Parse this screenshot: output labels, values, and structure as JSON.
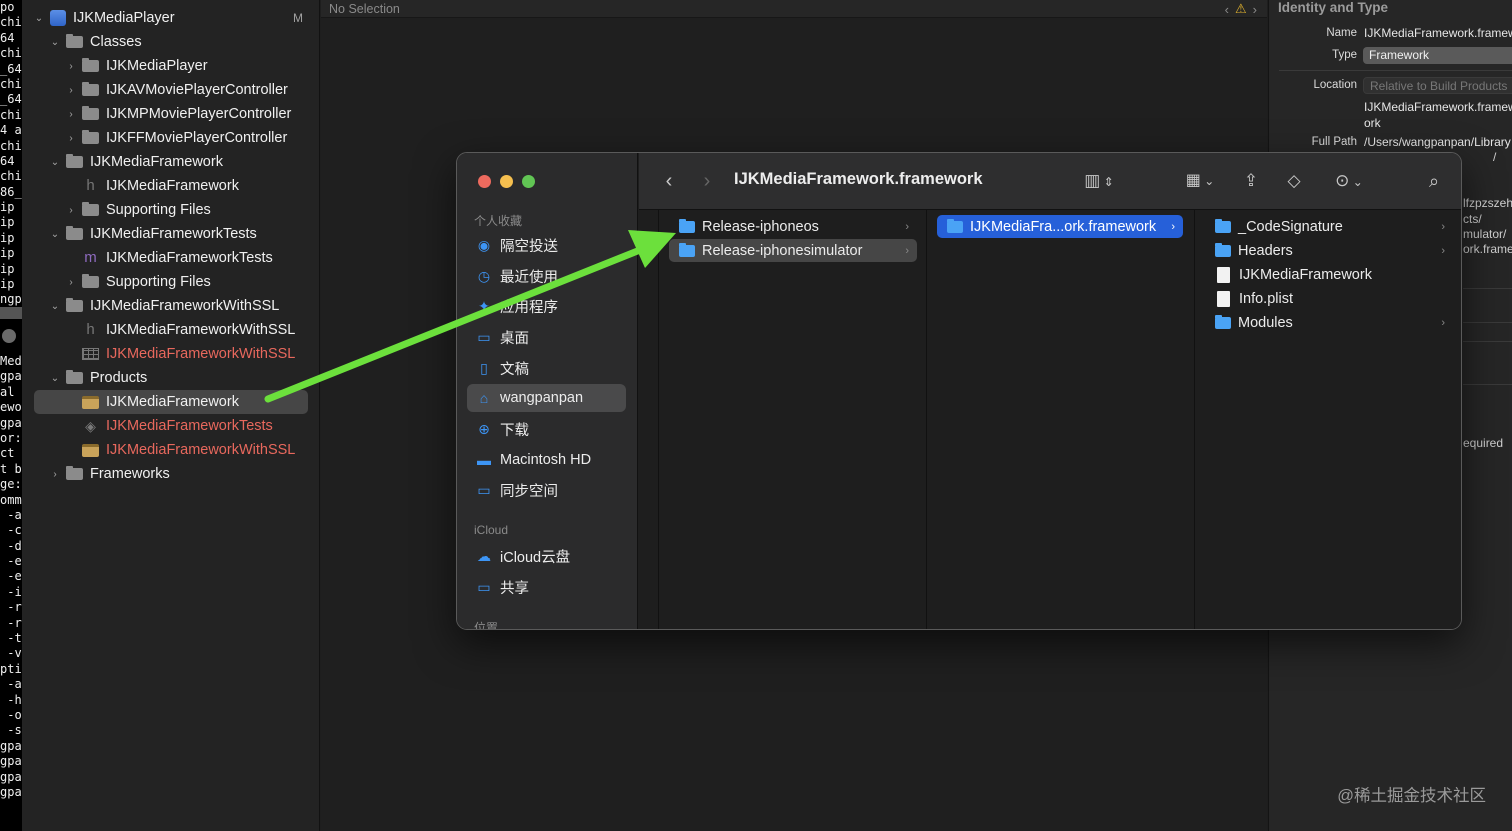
{
  "terminal": {
    "lines": [
      "po",
      "chi",
      "64",
      "chi",
      "_64",
      "chi",
      "_64",
      "chi",
      "4 a",
      "chi",
      "64",
      "chi",
      "86_",
      "ip",
      "ip",
      "ip",
      "ip",
      "ip",
      "ip",
      "ngp",
      "",
      "",
      "",
      "Med",
      "gpa",
      "al",
      "ewo",
      "gpa",
      "or:",
      "ct",
      "t b",
      "ge:",
      "omm",
      " -a",
      " -c",
      " -d",
      " -e",
      " -e",
      " -i",
      " -r",
      " -r",
      " -t",
      " -v",
      "pti",
      " -a",
      " -h",
      " -o",
      " -s",
      "gpa",
      "gpa",
      "gpa",
      "gpa"
    ]
  },
  "navigator": {
    "items": [
      {
        "label": "IJKMediaPlayer",
        "icon": "project-icon",
        "badge": "M"
      },
      {
        "label": "Classes",
        "icon": "folder-icon"
      },
      {
        "label": "IJKMediaPlayer",
        "icon": "folder-icon"
      },
      {
        "label": "IJKAVMoviePlayerController",
        "icon": "folder-icon"
      },
      {
        "label": "IJKMPMoviePlayerController",
        "icon": "folder-icon"
      },
      {
        "label": "IJKFFMoviePlayerController",
        "icon": "folder-icon"
      },
      {
        "label": "IJKMediaFramework",
        "icon": "folder-icon"
      },
      {
        "label": "IJKMediaFramework",
        "icon": "header-file-icon"
      },
      {
        "label": "Supporting Files",
        "icon": "folder-icon"
      },
      {
        "label": "IJKMediaFrameworkTests",
        "icon": "folder-icon"
      },
      {
        "label": "IJKMediaFrameworkTests",
        "icon": "source-file-icon"
      },
      {
        "label": "Supporting Files",
        "icon": "folder-icon"
      },
      {
        "label": "IJKMediaFrameworkWithSSL",
        "icon": "folder-icon"
      },
      {
        "label": "IJKMediaFrameworkWithSSL",
        "icon": "header-file-icon"
      },
      {
        "label": "IJKMediaFrameworkWithSSL",
        "icon": "plist-icon"
      },
      {
        "label": "Products",
        "icon": "folder-icon"
      },
      {
        "label": "IJKMediaFramework",
        "icon": "framework-product-icon"
      },
      {
        "label": "IJKMediaFrameworkTests",
        "icon": "test-bundle-icon"
      },
      {
        "label": "IJKMediaFrameworkWithSSL",
        "icon": "framework-product-icon"
      },
      {
        "label": "Frameworks",
        "icon": "folder-icon"
      }
    ]
  },
  "editor": {
    "status": "No Selection",
    "nav_prev": "‹",
    "nav_next": "›",
    "warning_icon": "⚠"
  },
  "inspector": {
    "section_title": "Identity and Type",
    "name_key": "Name",
    "name_value": "IJKMediaFramework.framework",
    "type_key": "Type",
    "type_value": "Framework",
    "location_key": "Location",
    "location_value": "Relative to Build Products",
    "location_path_1": "IJKMediaFramework.framew",
    "location_path_2": "ork",
    "fullpath_key": "Full Path",
    "fullpath_value": "/Users/wangpanpan/Library",
    "frag_1": "/",
    "frag_2": "lfzpzszeh",
    "frag_3": "cts/",
    "frag_4": "mulator/",
    "frag_5": "ork.frame",
    "frag_6": "equired"
  },
  "finder": {
    "title": "IJKMediaFramework.framework",
    "sidebar": {
      "favorites_header": "个人收藏",
      "favorites": [
        {
          "label": "隔空投送",
          "icon": "airdrop-icon",
          "glyph": "◉"
        },
        {
          "label": "最近使用",
          "icon": "recents-icon",
          "glyph": "◷"
        },
        {
          "label": "应用程序",
          "icon": "applications-icon",
          "glyph": "✦"
        },
        {
          "label": "桌面",
          "icon": "desktop-icon",
          "glyph": "▭"
        },
        {
          "label": "文稿",
          "icon": "documents-icon",
          "glyph": "▯"
        },
        {
          "label": "wangpanpan",
          "icon": "home-icon",
          "glyph": "⌂"
        },
        {
          "label": "下载",
          "icon": "downloads-icon",
          "glyph": "⊕"
        },
        {
          "label": "Macintosh HD",
          "icon": "disk-icon",
          "glyph": "▬"
        },
        {
          "label": "同步空间",
          "icon": "sync-folder-icon",
          "glyph": "▭"
        }
      ],
      "icloud_header": "iCloud",
      "icloud": [
        {
          "label": "iCloud云盘",
          "icon": "icloud-icon",
          "glyph": "☁"
        },
        {
          "label": "共享",
          "icon": "shared-folder-icon",
          "glyph": "▭"
        }
      ],
      "locations_header": "位置"
    },
    "column1": [
      {
        "label": "Release-iphoneos",
        "has_children": true
      },
      {
        "label": "Release-iphonesimulator",
        "has_children": true
      }
    ],
    "column2": [
      {
        "label": "IJKMediaFra...ork.framework",
        "has_children": true
      }
    ],
    "column3": [
      {
        "label": "_CodeSignature",
        "kind": "folder",
        "has_children": true
      },
      {
        "label": "Headers",
        "kind": "folder",
        "has_children": true
      },
      {
        "label": "IJKMediaFramework",
        "kind": "file",
        "has_children": false
      },
      {
        "label": "Info.plist",
        "kind": "file",
        "has_children": false
      },
      {
        "label": "Modules",
        "kind": "folder",
        "has_children": true
      }
    ],
    "chevron": "›"
  },
  "annotation": {
    "arrow_color": "#6ce03c"
  },
  "watermark": "@稀土掘金技术社区"
}
